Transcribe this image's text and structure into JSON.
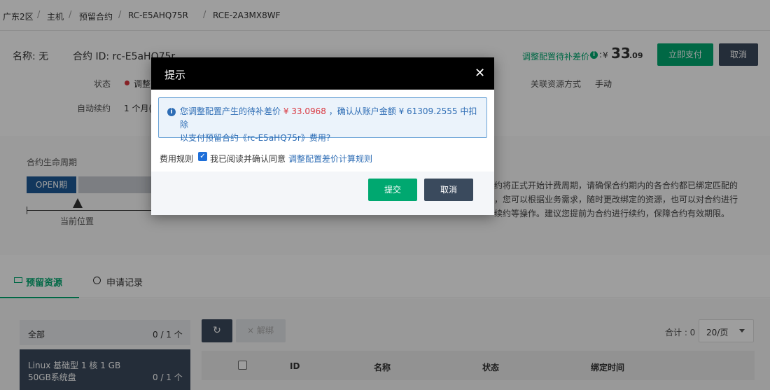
{
  "breadcrumb": [
    "广东2区",
    "主机",
    "预留合约",
    "RC-E5AHQ75R",
    "RCE-2A3MX8WF"
  ],
  "header": {
    "name_label": "名称: 无",
    "contract_label": "合约 ID: rc-E5aHQ75r",
    "status_label": "状态",
    "status_value": "调整",
    "auto_renew_label": "自动续约",
    "auto_renew_value": "1 个月(",
    "link_mode_label": "关联资源方式",
    "link_mode_value": "手动",
    "pending_label": "调整配置待补差价",
    "currency": "¥",
    "amount_int": "33",
    "amount_dec": ".09",
    "pay_button": "立即支付",
    "cancel_button": "取消"
  },
  "lifecycle": {
    "title": "合约生命周期",
    "open_badge": "OPEN期",
    "current_position": "当前位置",
    "desc_line1": "约将正式开始计费周期，请确保合约期内的各合约都已绑定匹配的",
    "desc_line2": "，您可以根据业务需求，随时更改绑定的资源，也可以对合约进行",
    "desc_line3": "续约等操作。建议您提前为合约进行续约，保障合约有效期限。"
  },
  "tabs": [
    {
      "label": "预留资源",
      "icon": "monitor-icon"
    },
    {
      "label": "申请记录",
      "icon": "clock-icon"
    }
  ],
  "resources": {
    "all_label": "全部",
    "all_count": "0 / 1 个",
    "item_line1": "Linux  基础型  1 核  1 GB",
    "item_line2": "50GB系统盘",
    "item_count": "0 / 1 个"
  },
  "toolbar": {
    "unbind_label": "解绑",
    "total_label": "合计 : 0",
    "page_size": "20/页"
  },
  "table": {
    "columns": [
      "ID",
      "名称",
      "状态",
      "绑定时间"
    ]
  },
  "dialog": {
    "title": "提示",
    "msg_part1": "您调整配置产生的待补差价",
    "msg_amount": "¥ 33.0968",
    "msg_part2": "，确认从账户金额 ¥ 61309.2555 中扣除",
    "msg_line2": "以支付预留合约《rc-E5aHQ75r》费用?",
    "fee_rule_label": "费用规则",
    "agree_text": "我已阅读并确认同意",
    "rule_link": "调整配置差价计算规则",
    "submit_button": "提交",
    "cancel_button": "取消"
  },
  "colors": {
    "accent_green": "#00a870",
    "dark_button": "#3a4a5d",
    "link_blue": "#2e6db5",
    "price_red": "#d9363e"
  }
}
